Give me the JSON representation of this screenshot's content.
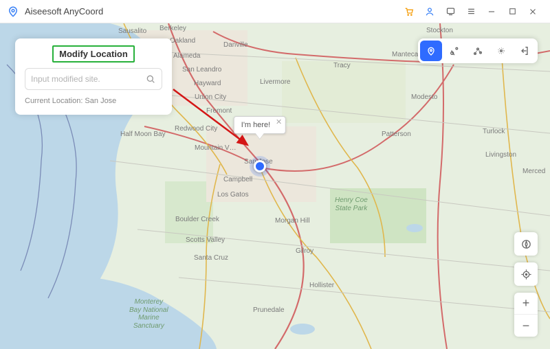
{
  "app": {
    "title": "Aiseesoft AnyCoord"
  },
  "panel": {
    "title": "Modify Location",
    "search_placeholder": "Input modified site.",
    "current_label": "Current Location: San Jose"
  },
  "popup": {
    "text": "I'm here!"
  },
  "map_labels": {
    "sausalito": "Sausalito",
    "berkeley": "Berkeley",
    "oakland": "Oakland",
    "alameda": "Alameda",
    "san_leandro": "San Leandro",
    "hayward": "Hayward",
    "danville": "Danville",
    "livermore": "Livermore",
    "stockton": "Stockton",
    "tracy": "Tracy",
    "manteca": "Manteca",
    "fremont": "Fremont",
    "union_city": "Union City",
    "half_moon_bay": "Half Moon Bay",
    "redwood_city": "Redwood City",
    "patterson": "Patterson",
    "turlock": "Turlock",
    "modesto": "Modesto",
    "mountain_view": "Mountain V…",
    "san_jose": "San Jose",
    "campbell": "Campbell",
    "los_gatos": "Los Gatos",
    "livingston": "Livingston",
    "merced": "Merced",
    "boulder_creek": "Boulder Creek",
    "scotts_valley": "Scotts Valley",
    "morgan_hill": "Morgan Hill",
    "santa_cruz": "Santa Cruz",
    "gilroy": "Gilroy",
    "hollister": "Hollister",
    "prunedale": "Prunedale",
    "henry_coe": "Henry Coe\nState Park",
    "monterey": "Monterey\nBay National\nMarine\nSanctuary"
  },
  "colors": {
    "water": "#bcd7e8",
    "land": "#e7efe0",
    "urban": "#e9e4da",
    "highway": "#d36a6a",
    "road": "#e0b74d"
  }
}
